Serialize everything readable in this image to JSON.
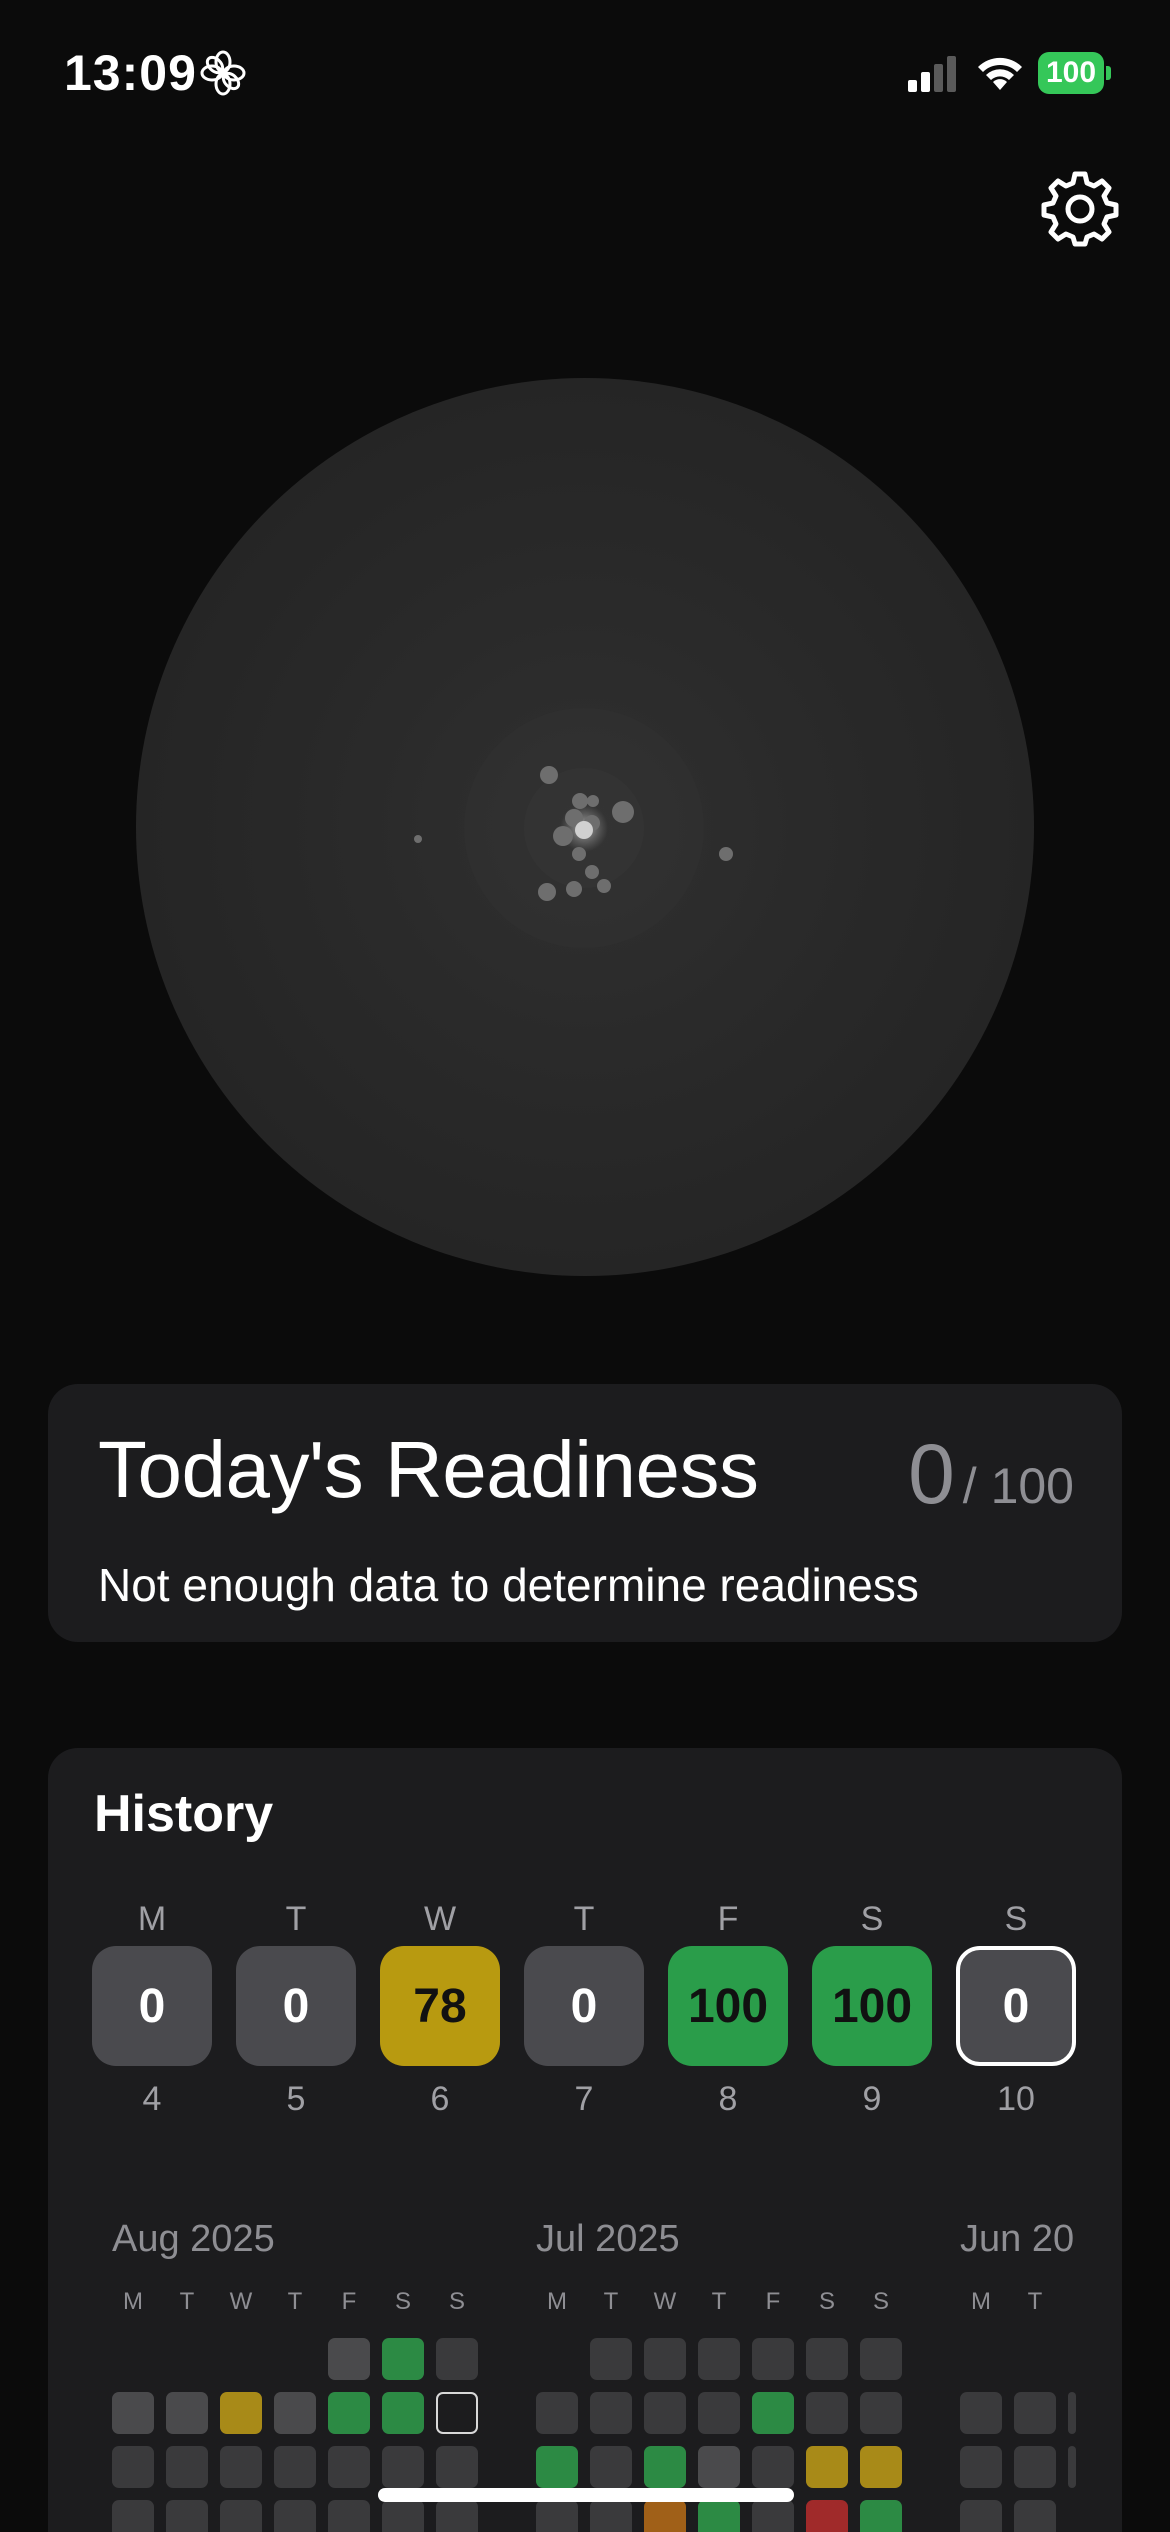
{
  "status_bar": {
    "time": "13:09",
    "battery": "100"
  },
  "readiness": {
    "title": "Today's Readiness",
    "score": "0",
    "score_total": "/ 100",
    "message": "Not enough data to determine readiness"
  },
  "history": {
    "title": "History",
    "week": [
      {
        "letter": "M",
        "value": "0",
        "date": "4",
        "state": "gray"
      },
      {
        "letter": "T",
        "value": "0",
        "date": "5",
        "state": "gray"
      },
      {
        "letter": "W",
        "value": "78",
        "date": "6",
        "state": "yellow"
      },
      {
        "letter": "T",
        "value": "0",
        "date": "7",
        "state": "gray"
      },
      {
        "letter": "F",
        "value": "100",
        "date": "8",
        "state": "green"
      },
      {
        "letter": "S",
        "value": "100",
        "date": "9",
        "state": "green"
      },
      {
        "letter": "S",
        "value": "0",
        "date": "10",
        "state": "selected"
      }
    ],
    "months": [
      {
        "label": "Aug 2025",
        "dow": [
          "M",
          "T",
          "W",
          "T",
          "F",
          "S",
          "S"
        ]
      },
      {
        "label": "Jul 2025",
        "dow": [
          "M",
          "T",
          "W",
          "T",
          "F",
          "S",
          "S"
        ]
      },
      {
        "label": "Jun 20",
        "dow": [
          "M",
          "T"
        ]
      }
    ]
  },
  "colors": {
    "green": "#2a9d4a",
    "yellow": "#b89a10",
    "gray": "#4a4a4e",
    "battery": "#35c759"
  }
}
